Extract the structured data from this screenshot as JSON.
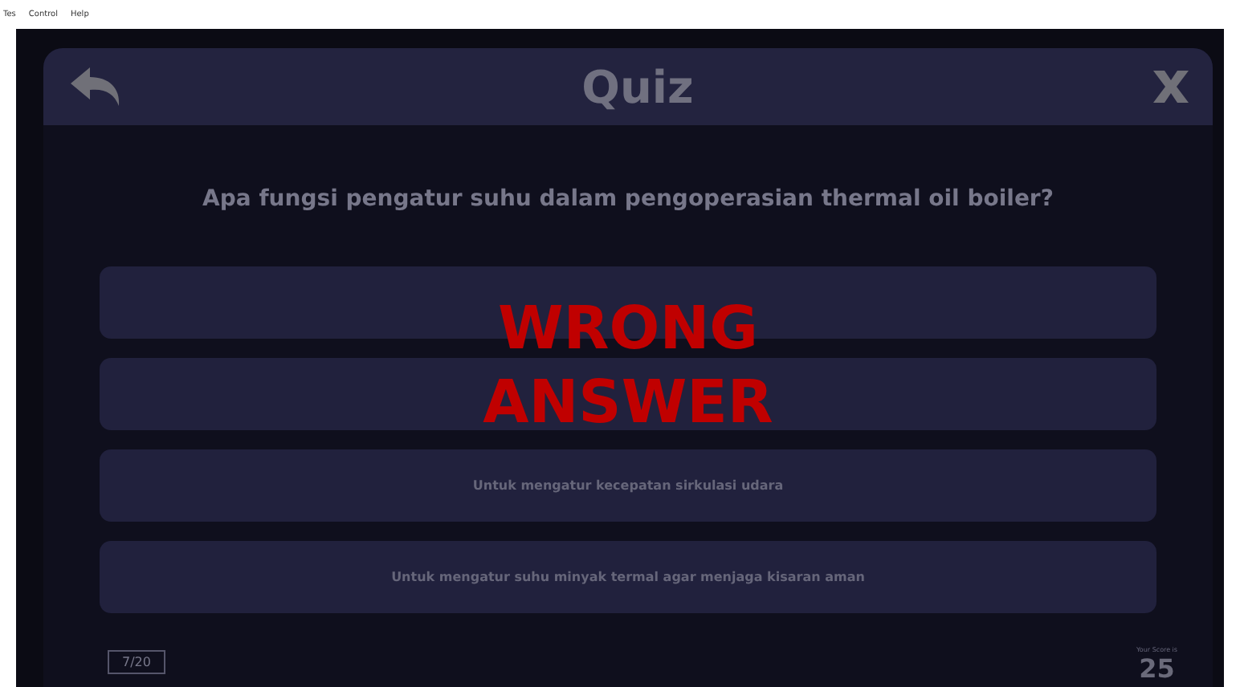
{
  "menu_bar": {
    "items": [
      "Tes",
      "Control",
      "Help"
    ]
  },
  "quiz": {
    "title": "Quiz",
    "question": "Apa fungsi pengatur suhu dalam pengoperasian thermal oil boiler?",
    "answers": [
      {
        "kind": "hidden"
      },
      {
        "kind": "hidden"
      },
      {
        "kind": "text",
        "text": "Untuk mengatur kecepatan sirkulasi udara"
      },
      {
        "kind": "text",
        "text": "Untuk mengatur suhu minyak termal agar menjaga kisaran aman"
      }
    ],
    "feedback": {
      "lines": [
        "WRONG",
        "ANSWER"
      ]
    },
    "progress": "7/20",
    "score_label": "Your Score is",
    "score": "25"
  }
}
